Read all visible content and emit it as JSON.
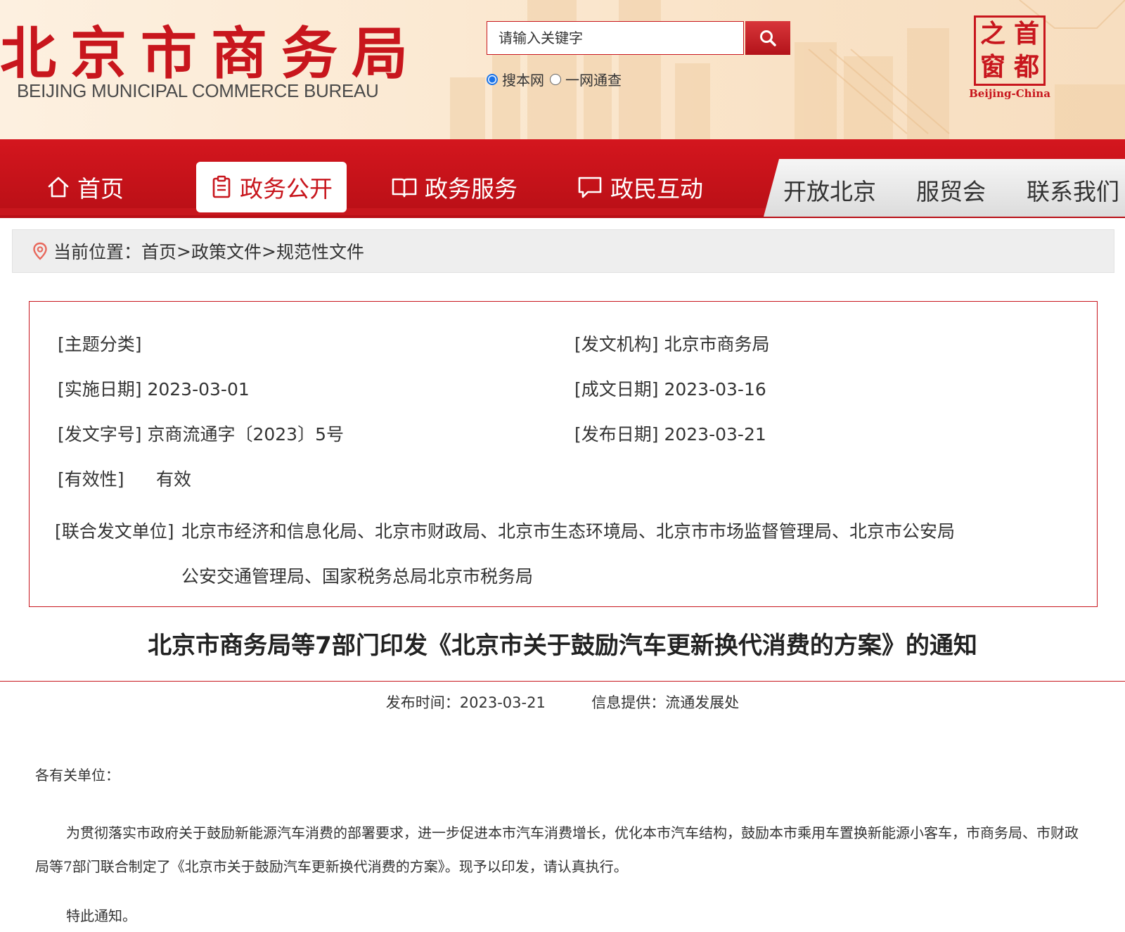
{
  "header": {
    "logo_cn": "北京市商务局",
    "logo_en": "BEIJING MUNICIPAL COMMERCE BUREAU",
    "search": {
      "placeholder": "请输入关键字"
    },
    "search_scope": {
      "option_site": "搜本网",
      "option_all": "一网通查",
      "selected": "搜本网"
    },
    "seal": {
      "chars": [
        "之",
        "首",
        "窗",
        "都"
      ],
      "caption": "Beijing-China"
    }
  },
  "nav": {
    "items": [
      {
        "label": "首页",
        "icon": "home-icon"
      },
      {
        "label": "政务公开",
        "icon": "clipboard-icon",
        "active": true
      },
      {
        "label": "政务服务",
        "icon": "book-icon"
      },
      {
        "label": "政民互动",
        "icon": "chat-icon"
      }
    ],
    "secondary": [
      {
        "label": "开放北京"
      },
      {
        "label": "服贸会"
      },
      {
        "label": "联系我们"
      }
    ]
  },
  "breadcrumb": {
    "prefix": "当前位置：",
    "items": [
      "首页",
      "政策文件",
      "规范性文件"
    ],
    "separator": ">"
  },
  "info": {
    "topic": {
      "label": "[主题分类]",
      "value": ""
    },
    "issuer": {
      "label": "[发文机构]",
      "value": "北京市商务局"
    },
    "effective_date": {
      "label": "[实施日期]",
      "value": "2023-03-01"
    },
    "written_date": {
      "label": "[成文日期]",
      "value": "2023-03-16"
    },
    "doc_number": {
      "label": "[发文字号]",
      "value": "京商流通字〔2023〕5号"
    },
    "publish_date": {
      "label": "[发布日期]",
      "value": "2023-03-21"
    },
    "validity": {
      "label": "[有效性]",
      "value": "有效"
    },
    "joint_issuers": {
      "label": "[联合发文单位]",
      "value": "北京市经济和信息化局、北京市财政局、北京市生态环境局、北京市市场监督管理局、北京市公安局公安交通管理局、国家税务总局北京市税务局"
    }
  },
  "article": {
    "title": "北京市商务局等7部门印发《北京市关于鼓励汽车更新换代消费的方案》的通知",
    "publish_time_label": "发布时间：",
    "publish_time": "2023-03-21",
    "provider_label": "信息提供：",
    "provider": "流通发展处",
    "salutation": "各有关单位：",
    "paragraph": "为贯彻落实市政府关于鼓励新能源汽车消费的部署要求，进一步促进本市汽车消费增长，优化本市汽车结构，鼓励本市乘用车置换新能源小客车，市商务局、市财政局等7部门联合制定了《北京市关于鼓励汽车更新换代消费的方案》。现予以印发，请认真执行。",
    "closing": "特此通知。"
  },
  "colors": {
    "brand_red": "#c8161d",
    "nav_gray": "#e6e6e6",
    "breadcrumb_bg": "#eeeeee"
  }
}
